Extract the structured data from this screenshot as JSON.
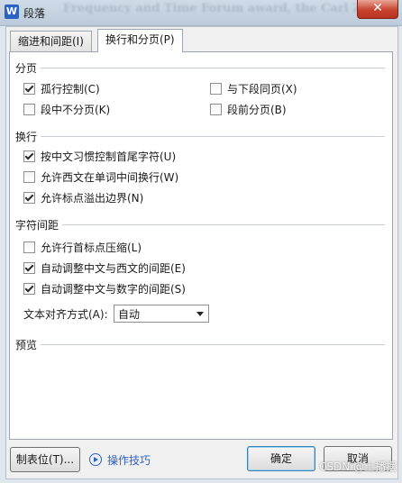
{
  "window": {
    "title": "段落",
    "app_icon_letter": "W",
    "background_text": "Frequency and Time Forum award, the Carl Zei",
    "close_glyph": "✕"
  },
  "tabs": [
    {
      "label": "缩进和间距(I)",
      "active": false
    },
    {
      "label": "换行和分页(P)",
      "active": true
    }
  ],
  "sections": {
    "pagination": {
      "title": "分页",
      "options": [
        {
          "label": "孤行控制(C)",
          "checked": true
        },
        {
          "label": "与下段同页(X)",
          "checked": false
        },
        {
          "label": "段中不分页(K)",
          "checked": false
        },
        {
          "label": "段前分页(B)",
          "checked": false
        }
      ]
    },
    "line_break": {
      "title": "换行",
      "options": [
        {
          "label": "按中文习惯控制首尾字符(U)",
          "checked": true
        },
        {
          "label": "允许西文在单词中间换行(W)",
          "checked": false
        },
        {
          "label": "允许标点溢出边界(N)",
          "checked": true
        }
      ]
    },
    "char_spacing": {
      "title": "字符间距",
      "options": [
        {
          "label": "允许行首标点压缩(L)",
          "checked": false
        },
        {
          "label": "自动调整中文与西文的间距(E)",
          "checked": true
        },
        {
          "label": "自动调整中文与数字的间距(S)",
          "checked": true
        }
      ],
      "align_label": "文本对齐方式(A):",
      "align_value": "自动"
    },
    "preview": {
      "title": "预览"
    }
  },
  "buttons": {
    "tabs_button": "制表位(T)...",
    "tips": "操作技巧",
    "ok": "确定",
    "cancel": "取消"
  },
  "watermark": "CSDN @土播摆"
}
